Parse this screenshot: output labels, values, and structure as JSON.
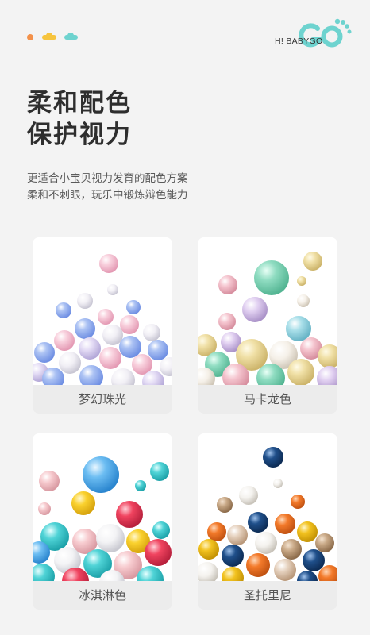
{
  "brand": {
    "name": "H! BABYGO",
    "logo_text": "GO",
    "logo_color": "#6ed3cf"
  },
  "heading": {
    "line1": "柔和配色",
    "line2": "保护视力"
  },
  "subtitle": {
    "line1": "更适合小宝贝视力发育的配色方案",
    "line2": "柔和不刺眼，玩乐中锻炼辩色能力"
  },
  "cards": [
    {
      "label": "梦幻珠光",
      "palette": [
        "#f7c9d6",
        "#bcd3f5",
        "#8ea9ef",
        "#e9e6f2",
        "#f3b8cc",
        "#ffffff"
      ]
    },
    {
      "label": "马卡龙色",
      "palette": [
        "#efdfa3",
        "#8fdcc1",
        "#f2c1cc",
        "#d9c8ef",
        "#a9dfe9",
        "#f6efe2"
      ]
    },
    {
      "label": "冰淇淋色",
      "palette": [
        "#5fb6f0",
        "#f0435f",
        "#fad12e",
        "#4fd3d6",
        "#f7cbcf",
        "#ffffff"
      ]
    },
    {
      "label": "圣托里尼",
      "palette": [
        "#1f4f8a",
        "#f37a2a",
        "#f2c21f",
        "#e6d2bf",
        "#c9a987",
        "#f4f2ee"
      ]
    }
  ],
  "colors": {
    "background": "#f3f3f3",
    "caption_bg": "#ececec",
    "accent_orange": "#f3914a",
    "accent_yellow": "#f6c43e",
    "accent_teal": "#6ed3cf"
  }
}
